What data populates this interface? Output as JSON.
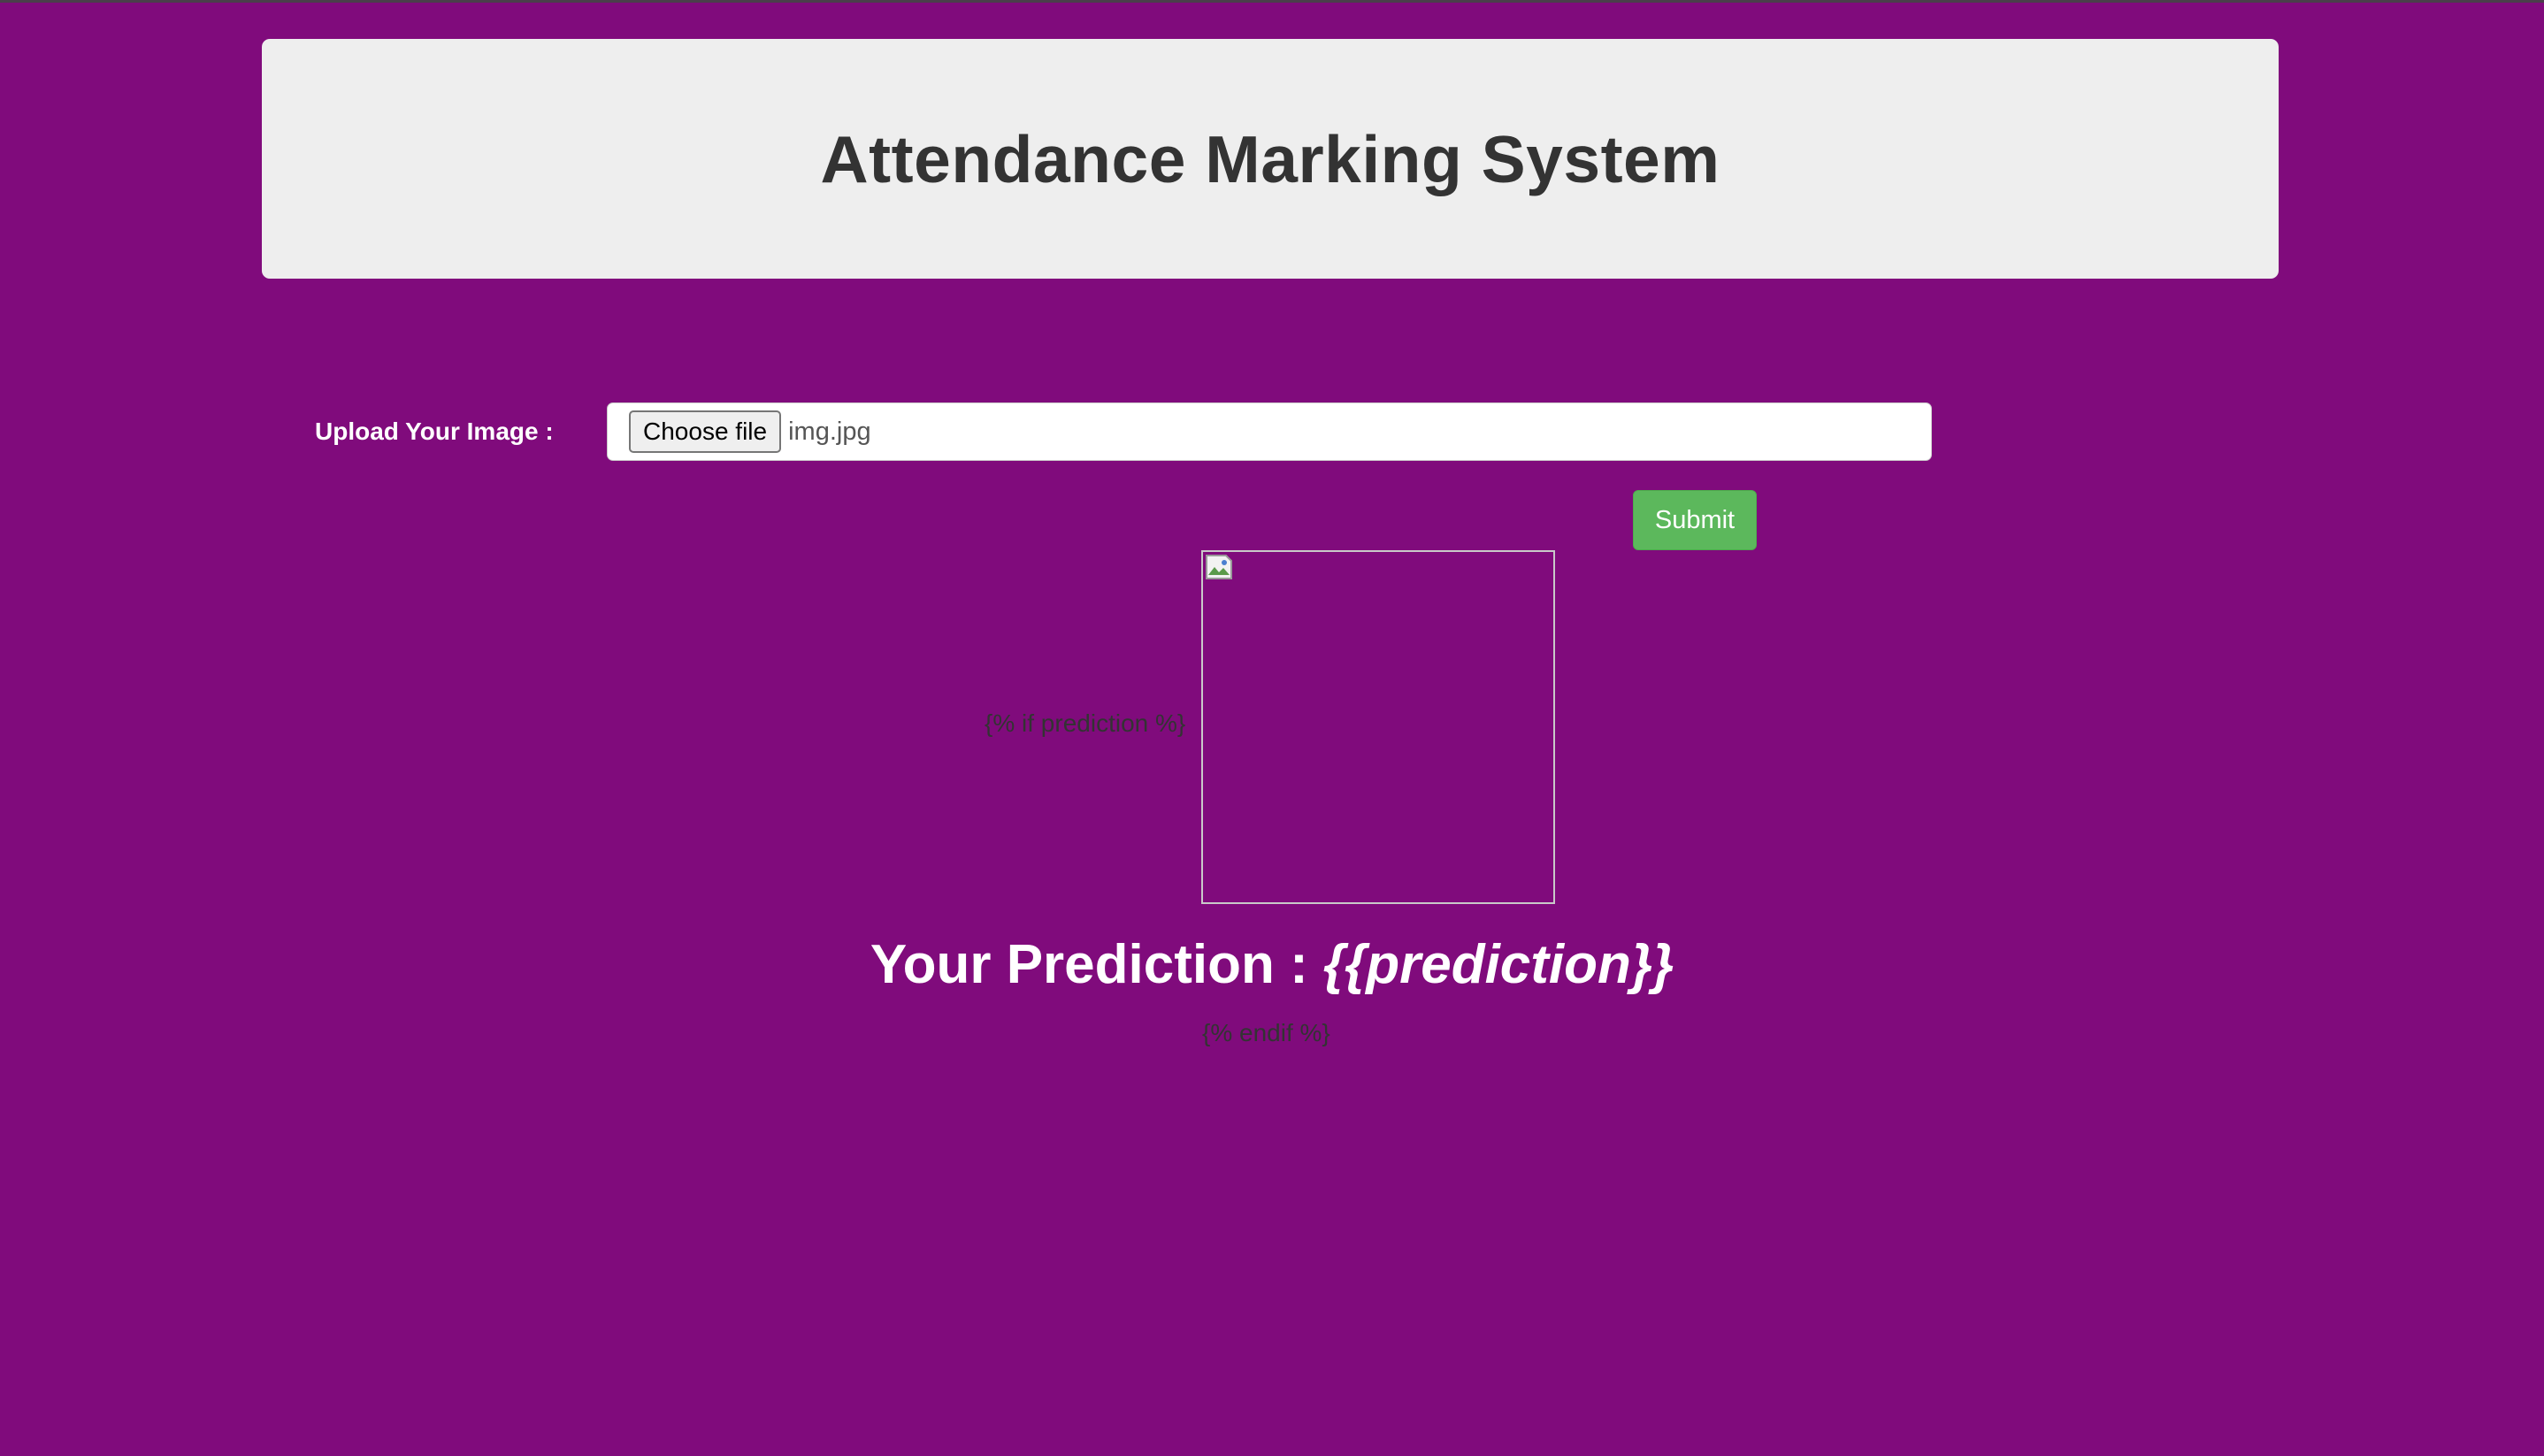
{
  "header": {
    "title": "Attendance Marking System"
  },
  "upload": {
    "label": "Upload Your Image :",
    "choose_button": "Choose file",
    "file_name": "img.jpg"
  },
  "form": {
    "submit_label": "Submit"
  },
  "result": {
    "if_tag": "{% if prediction %}",
    "prediction_prefix": "Your Prediction : ",
    "prediction_value": "{{prediction}}",
    "endif_tag": "{% endif %}",
    "image_icon": "broken-image-icon"
  },
  "colors": {
    "background": "#800b7c",
    "header_bg": "#eeeeee",
    "submit_bg": "#5cb85c"
  }
}
